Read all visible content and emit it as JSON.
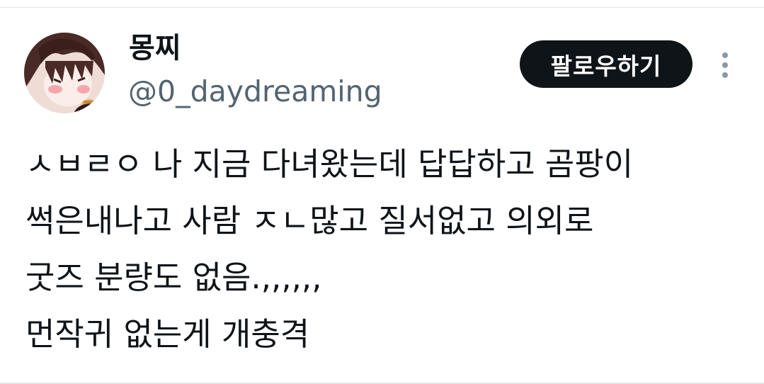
{
  "author": {
    "display_name": "몽찌",
    "handle": "@0_daydreaming"
  },
  "actions": {
    "follow_label": "팔로우하기",
    "more_icon": "more-vertical-icon"
  },
  "tweet": {
    "lines": [
      "ㅅㅂㄹㅇ 나 지금 다녀왔는데 답답하고 곰팡이",
      "썩은내나고 사람 ㅈㄴ많고 질서없고 의외로",
      "굿즈 분량도 없음.,,,,,,",
      "먼작귀 없는게 개충격"
    ]
  },
  "colors": {
    "text_primary": "#0f1419",
    "text_secondary": "#536471",
    "button_bg": "#0f1419",
    "divider": "#e1e4e8"
  }
}
